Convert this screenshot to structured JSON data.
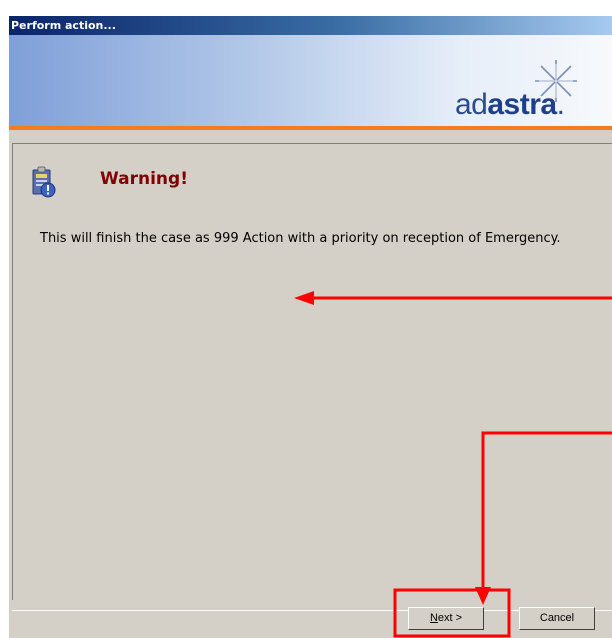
{
  "window": {
    "title": "Perform action..."
  },
  "banner": {
    "logo_part1": "ad",
    "logo_part2": "astra"
  },
  "dialog": {
    "warning_title": "Warning!",
    "message": "This will finish the case as 999 Action with a priority on reception of Emergency."
  },
  "buttons": {
    "next_mnemonic": "N",
    "next_rest": "ext >",
    "cancel_label": "Cancel"
  },
  "icons": {
    "warning": "warning-clipboard-icon",
    "logo_star": "star-burst-icon"
  },
  "colors": {
    "title_bar": "#0a246a",
    "accent_rule": "#f47b20",
    "warning_text": "#800000",
    "annotation": "#ff0000"
  }
}
